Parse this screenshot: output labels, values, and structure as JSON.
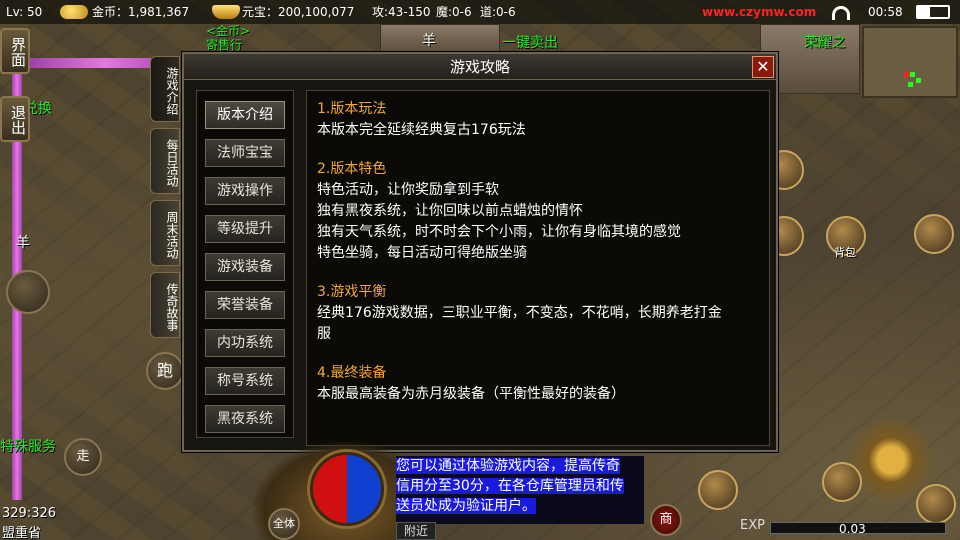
{
  "status_bar": {
    "level": "Lv: 50",
    "gold_label": "金币：1,981,367",
    "yuanbao_label": "元宝：200,100,077",
    "attack": "攻:43-150",
    "magic": "魔:0-6",
    "tao": "道:0-6",
    "website": "www.czymw.com",
    "clock": "00:58"
  },
  "world_labels": {
    "gold_shop": "<金币>",
    "consignment": "寄售行",
    "sheep_top": "羊",
    "one_click_sell": "一键卖出",
    "honor": "荣耀之",
    "exchange": "兑换",
    "sheep_left": "羊",
    "special_service": "特殊服务",
    "bag": "背包",
    "coordinates": "329:326",
    "map_name": "盟重省"
  },
  "side_buttons": {
    "interface": "界面",
    "exit": "退出",
    "run": "跑",
    "walk": "走"
  },
  "vertical_tabs": [
    {
      "label": "游戏介绍",
      "active": true
    },
    {
      "label": "每日活动",
      "active": false
    },
    {
      "label": "周末活动",
      "active": false
    },
    {
      "label": "传奇故事",
      "active": false
    }
  ],
  "dialog": {
    "title": "游戏攻略",
    "close": "✕",
    "menu": [
      {
        "label": "版本介绍",
        "active": true
      },
      {
        "label": "法师宝宝",
        "active": false
      },
      {
        "label": "游戏操作",
        "active": false
      },
      {
        "label": "等级提升",
        "active": false
      },
      {
        "label": "游戏装备",
        "active": false
      },
      {
        "label": "荣誉装备",
        "active": false
      },
      {
        "label": "内功系统",
        "active": false
      },
      {
        "label": "称号系统",
        "active": false
      },
      {
        "label": "黑夜系统",
        "active": false
      }
    ],
    "sections": [
      {
        "title": "1.版本玩法",
        "lines": [
          "本版本完全延续经典复古176玩法"
        ]
      },
      {
        "title": "2.版本特色",
        "lines": [
          "特色活动，让你奖励拿到手软",
          "独有黑夜系统，让你回味以前点蜡烛的情怀",
          "独有天气系统，时不时会下个小雨，让你有身临其境的感觉",
          "特色坐骑，每日活动可得绝版坐骑"
        ]
      },
      {
        "title": "3.游戏平衡",
        "lines": [
          "经典176游戏数据，三职业平衡，不变态，不花哨，长期养老打金",
          "服"
        ]
      },
      {
        "title": "4.最终装备",
        "lines": [
          "本服最高装备为赤月级装备（平衡性最好的装备）"
        ]
      }
    ]
  },
  "chat": {
    "lines": [
      "您可以通过体验游戏内容，提高传奇",
      "信用分至30分，在各仓库管理员和传",
      "送员处成为验证用户。"
    ],
    "tab": "附近"
  },
  "hud": {
    "all_mode": "全体",
    "shop": "商",
    "exp_label": "EXP",
    "exp_value": "0.03",
    "exp_fraction": 0.0003
  }
}
